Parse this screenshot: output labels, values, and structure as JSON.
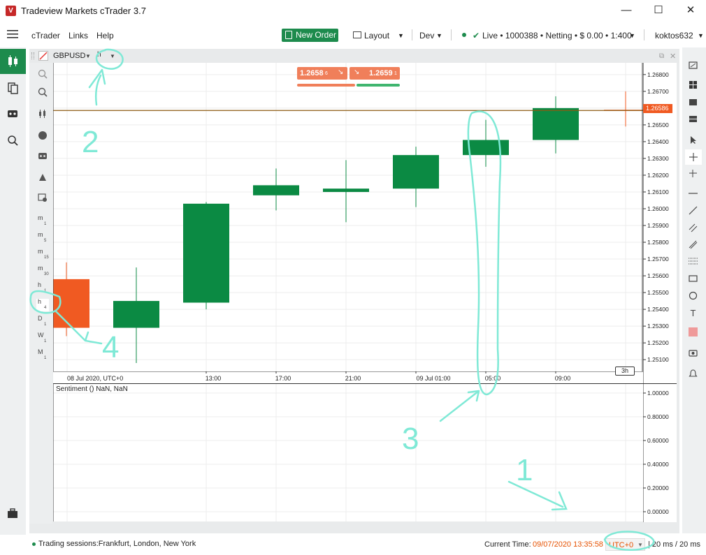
{
  "window": {
    "title": "Tradeview Markets cTrader 3.7",
    "controls": {
      "minimize": "—",
      "maximize": "☐",
      "close": "✕"
    }
  },
  "menu": {
    "items": [
      "cTrader",
      "Links",
      "Help"
    ]
  },
  "toolbar": {
    "new_order": "New Order",
    "layout": "Layout",
    "workspace": "Dev",
    "account": "Live • 1000388 • Netting • $ 0.00 • 1:400",
    "user": "koktos632"
  },
  "chart": {
    "symbol": "GBPUSD",
    "timeframe": "h",
    "sell_price": "1.2658",
    "sell_pip": "6",
    "buy_price": "1.2659",
    "buy_pip": "1",
    "current_price_label": "1.26586",
    "sentiment_label": "Sentiment () NaN, NaN",
    "period_label": "3h",
    "timeframes": [
      {
        "main": "m",
        "sub": "1"
      },
      {
        "main": "m",
        "sub": "5"
      },
      {
        "main": "m",
        "sub": "15"
      },
      {
        "main": "m",
        "sub": "30"
      },
      {
        "main": "h",
        "sub": "1"
      },
      {
        "main": "h",
        "sub": "4"
      },
      {
        "main": "D",
        "sub": "1"
      },
      {
        "main": "W",
        "sub": "1"
      },
      {
        "main": "M",
        "sub": "1"
      }
    ],
    "colors": {
      "bull": "#0b8a43",
      "bear": "#f05a22",
      "price_line": "#8b5a12",
      "annotation": "#7fe9d6"
    }
  },
  "chart_data": {
    "type": "candlestick",
    "symbol": "GBPUSD",
    "timeframe": "h4",
    "categories": [
      "08 Jul 2020 09:00",
      "08 Jul 2020 13:00",
      "08 Jul 2020 17:00",
      "08 Jul 2020 21:00",
      "09 Jul 2020 01:00",
      "09 Jul 2020 05:00",
      "09 Jul 2020 09:00",
      "09 Jul 2020 13:00"
    ],
    "x_tick_labels": [
      "08 Jul 2020, UTC+0",
      "13:00",
      "17:00",
      "21:00",
      "09 Jul 01:00",
      "05:00",
      "09:00"
    ],
    "candles": [
      {
        "open": 1.2558,
        "high": 1.2568,
        "low": 1.2524,
        "close": 1.2529
      },
      {
        "open": 1.2529,
        "high": 1.2565,
        "low": 1.2508,
        "close": 1.2545
      },
      {
        "open": 1.2544,
        "high": 1.2604,
        "low": 1.254,
        "close": 1.2603
      },
      {
        "open": 1.2608,
        "high": 1.2624,
        "low": 1.2599,
        "close": 1.2614
      },
      {
        "open": 1.261,
        "high": 1.2629,
        "low": 1.2592,
        "close": 1.2612
      },
      {
        "open": 1.2612,
        "high": 1.2637,
        "low": 1.2601,
        "close": 1.2632
      },
      {
        "open": 1.2632,
        "high": 1.2653,
        "low": 1.2625,
        "close": 1.2641
      },
      {
        "open": 1.2641,
        "high": 1.2667,
        "low": 1.2633,
        "close": 1.266
      },
      {
        "open": 1.2659,
        "high": 1.267,
        "low": 1.2649,
        "close": 1.26586
      }
    ],
    "y_ticks": [
      "1.26800",
      "1.26700",
      "1.26600",
      "1.26500",
      "1.26400",
      "1.26300",
      "1.26200",
      "1.26100",
      "1.26000",
      "1.25900",
      "1.25800",
      "1.25700",
      "1.25600",
      "1.25500",
      "1.25400",
      "1.25300",
      "1.25200",
      "1.25100"
    ],
    "ylim": [
      1.2503,
      1.2687
    ],
    "sentiment_ticks": [
      "1.00000",
      "0.80000",
      "0.60000",
      "0.40000",
      "0.20000",
      "0.00000"
    ],
    "current_price": 1.26586
  },
  "status": {
    "sessions": "Trading sessions:Frankfurt, London, New York",
    "current_time_label": "Current Time:",
    "current_time": "09/07/2020 13:35:58",
    "timezone": "UTC+0",
    "latency": "| 20 ms / 20 ms"
  },
  "annotations": [
    "1",
    "2",
    "3",
    "4"
  ]
}
